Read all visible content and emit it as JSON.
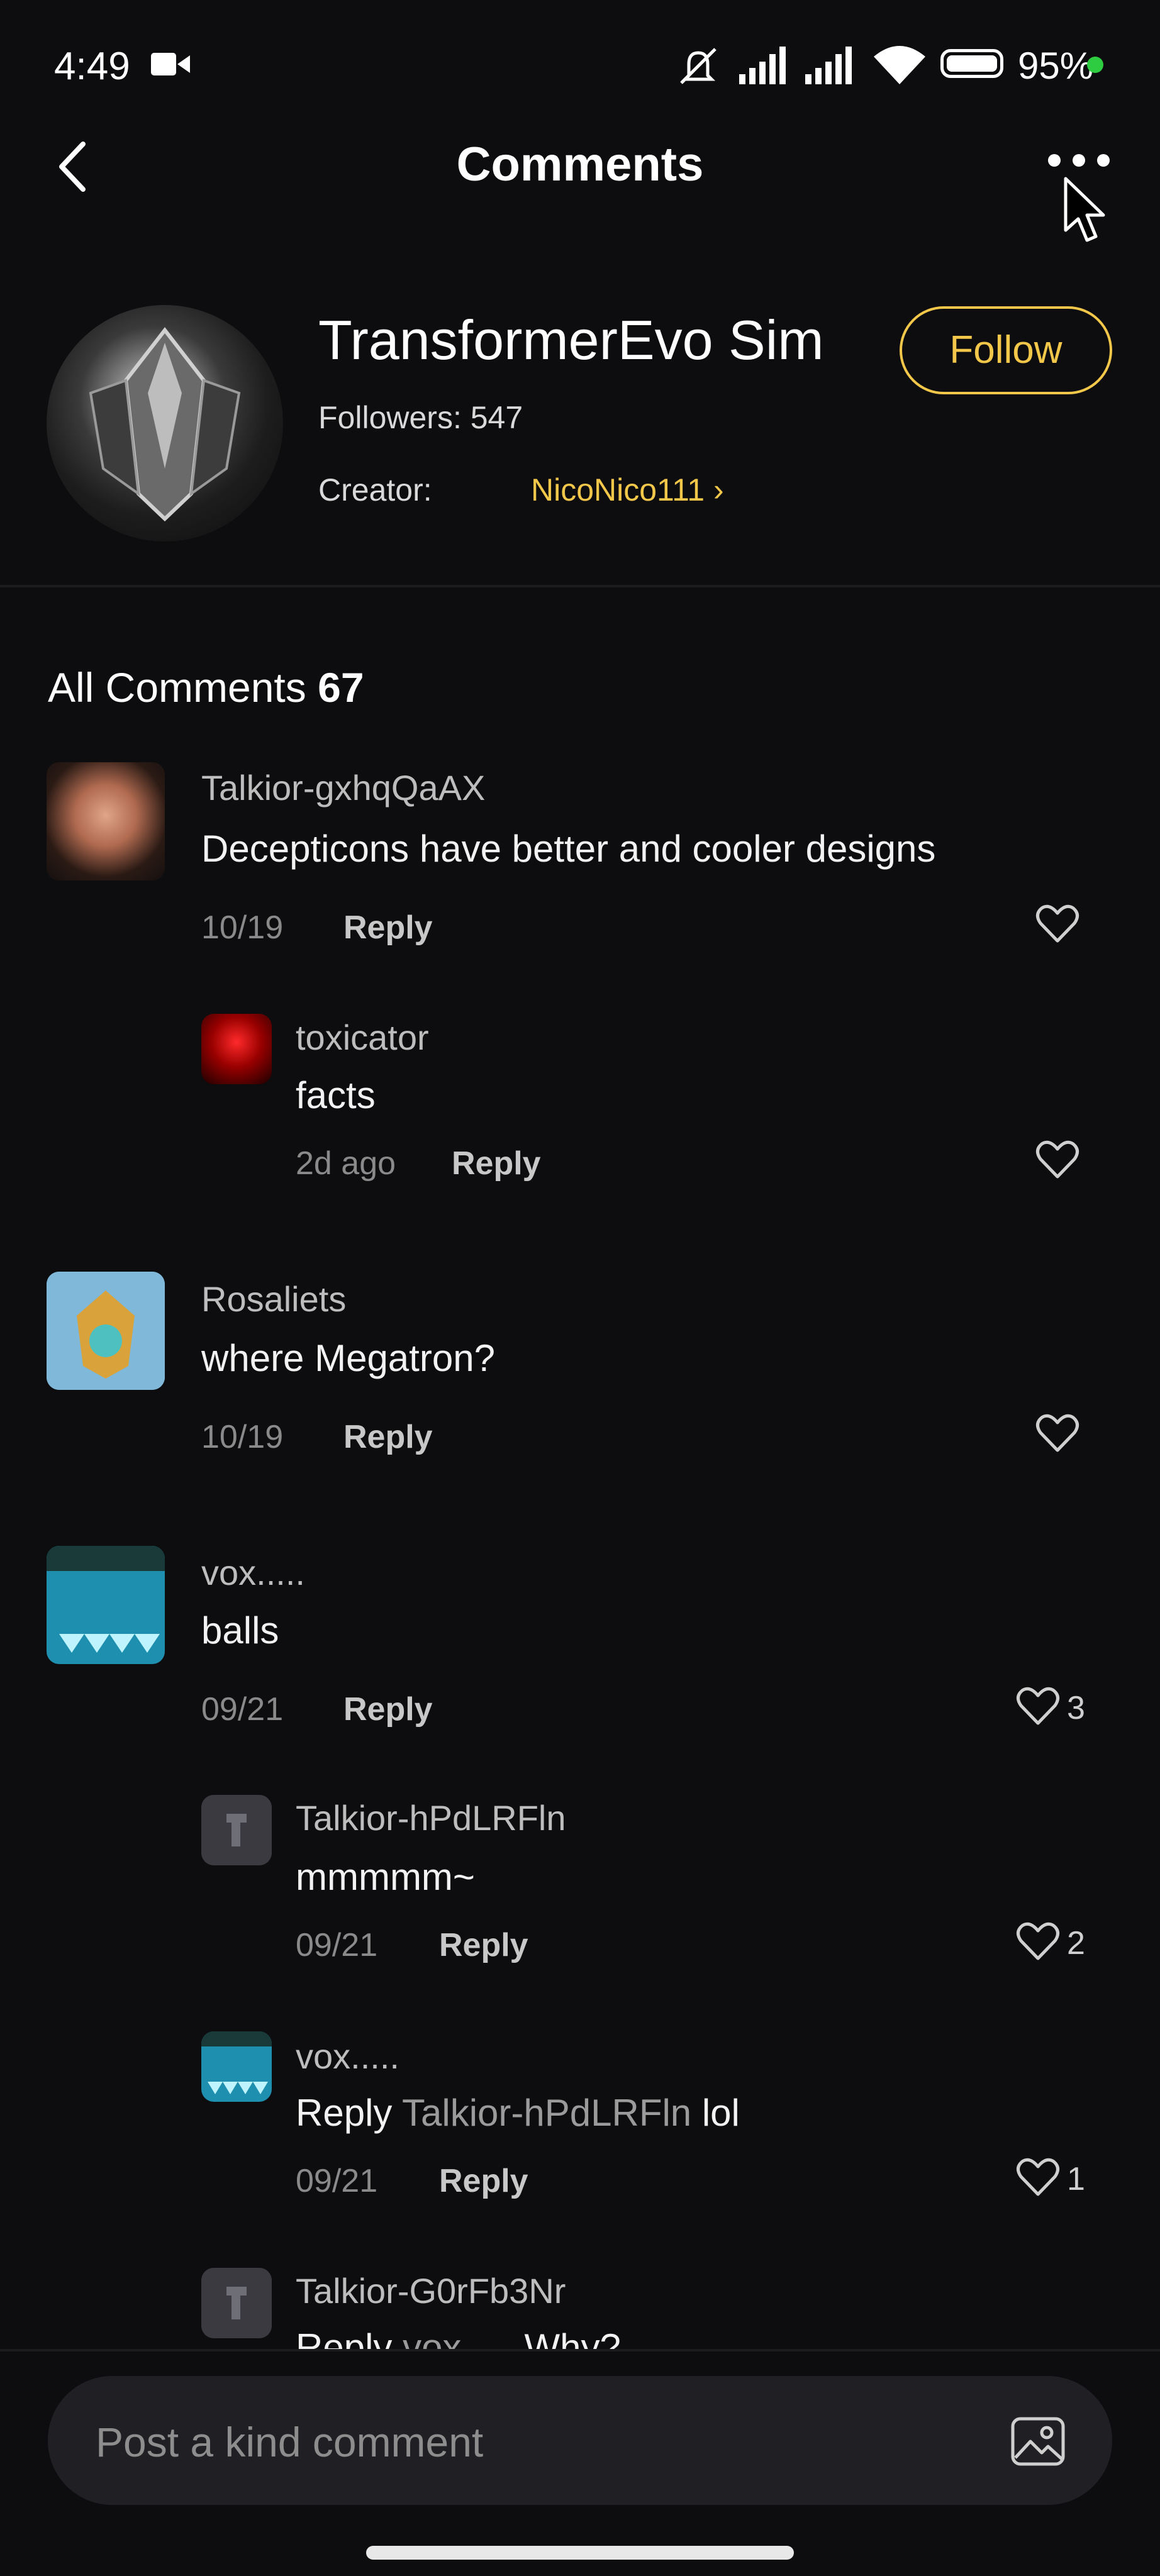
{
  "status_bar": {
    "time": "4:49",
    "battery": "95%"
  },
  "header": {
    "title": "Comments"
  },
  "profile": {
    "name": "TransformerEvo Sim",
    "followers": "Followers: 547",
    "creator_label": "Creator:",
    "creator_name": "NicoNico111 ›",
    "follow_label": "Follow"
  },
  "comments_header": {
    "label": "All Comments",
    "count": "67"
  },
  "comments": [
    {
      "user": "Talkior-gxhqQaAX",
      "text": "Decepticons have better and cooler designs",
      "date": "10/19",
      "reply": "Reply",
      "likes": ""
    },
    {
      "user": "toxicator",
      "text": "facts",
      "date": "2d ago",
      "reply": "Reply",
      "likes": ""
    },
    {
      "user": "Rosaliets",
      "text": "where Megatron?",
      "date": "10/19",
      "reply": "Reply",
      "likes": ""
    },
    {
      "user": "vox.....",
      "text": "balls",
      "date": "09/21",
      "reply": "Reply",
      "likes": "3"
    },
    {
      "user": "Talkior-hPdLRFln",
      "text": "mmmmm~",
      "date": "09/21",
      "reply": "Reply",
      "likes": "2"
    },
    {
      "user": "vox.....",
      "text_prefix": "Reply",
      "mention": "Talkior-hPdLRFln",
      "text": "lol",
      "date": "09/21",
      "reply": "Reply",
      "likes": "1"
    },
    {
      "user": "Talkior-G0rFb3Nr",
      "text_prefix": "Reply",
      "mention": "vox.....",
      "text": "Why?"
    }
  ],
  "composer": {
    "placeholder": "Post a kind comment"
  },
  "icons": {
    "back": "chevron-left-icon",
    "more": "more-dots-icon",
    "like": "heart-outline-icon",
    "image": "image-icon"
  }
}
